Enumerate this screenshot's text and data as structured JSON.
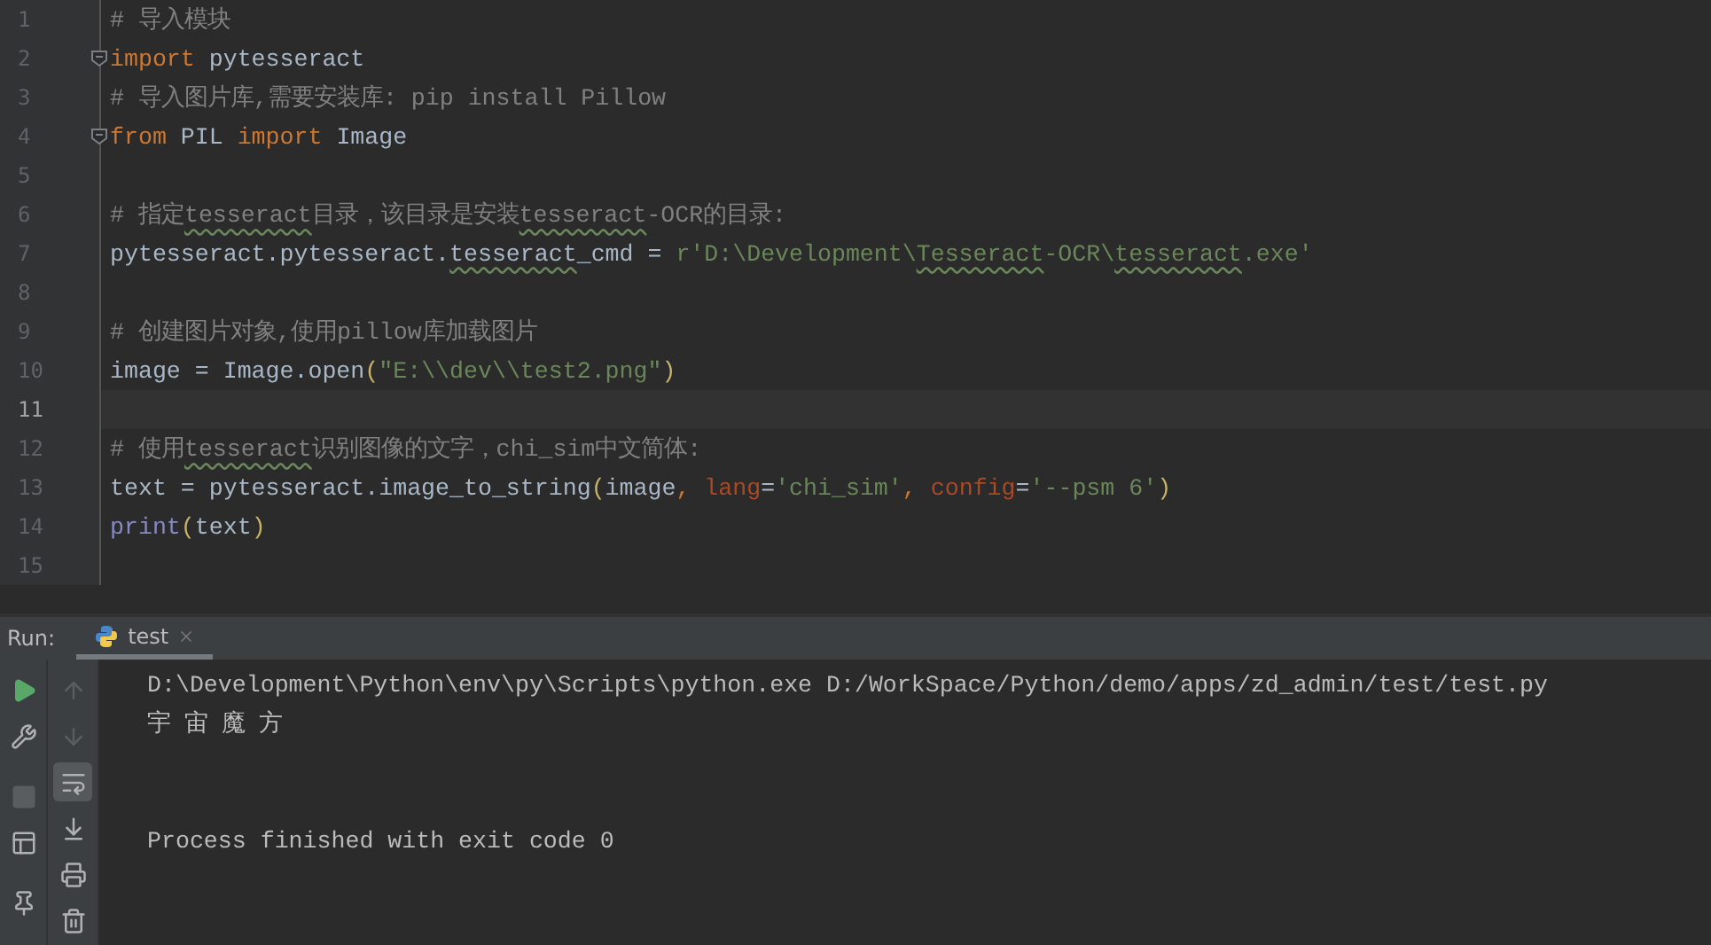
{
  "editor": {
    "lines": [
      {
        "number": "1",
        "current": false,
        "tokens": [
          {
            "kind": "comment",
            "text": "# 导入模块"
          }
        ]
      },
      {
        "number": "2",
        "current": false,
        "fold": true,
        "tokens": [
          {
            "kind": "keyword",
            "text": "import"
          },
          {
            "kind": "plain",
            "text": " pytesseract"
          }
        ]
      },
      {
        "number": "3",
        "current": false,
        "tokens": [
          {
            "kind": "comment",
            "text": "# 导入图片库,需要安装库: pip install Pillow"
          }
        ]
      },
      {
        "number": "4",
        "current": false,
        "fold": true,
        "tokens": [
          {
            "kind": "keyword",
            "text": "from"
          },
          {
            "kind": "plain",
            "text": " PIL "
          },
          {
            "kind": "keyword",
            "text": "import"
          },
          {
            "kind": "plain",
            "text": " Image"
          }
        ]
      },
      {
        "number": "5",
        "current": false
      },
      {
        "number": "6",
        "current": false,
        "tokens": [
          {
            "kind": "comment",
            "text": "# 指定"
          },
          {
            "kind": "comment_typo",
            "text": "tesseract"
          },
          {
            "kind": "comment",
            "text": "目录，该目录是安装"
          },
          {
            "kind": "comment_typo",
            "text": "tesseract"
          },
          {
            "kind": "comment",
            "text": "-OCR的目录:"
          }
        ]
      },
      {
        "number": "7",
        "current": false,
        "tokens": [
          {
            "kind": "plain",
            "text": "pytesseract.pytesseract."
          },
          {
            "kind": "plain_typo",
            "text": "tesseract"
          },
          {
            "kind": "plain",
            "text": "_cmd = "
          },
          {
            "kind": "string",
            "text": "r'D:\\Development\\"
          },
          {
            "kind": "string_typo",
            "text": "Tesseract"
          },
          {
            "kind": "string",
            "text": "-OCR\\"
          },
          {
            "kind": "string_typo",
            "text": "tesseract"
          },
          {
            "kind": "string",
            "text": ".exe'"
          }
        ]
      },
      {
        "number": "8",
        "current": false
      },
      {
        "number": "9",
        "current": false,
        "tokens": [
          {
            "kind": "comment",
            "text": "# 创建图片对象,使用pillow库加载图片"
          }
        ]
      },
      {
        "number": "10",
        "current": false,
        "tokens": [
          {
            "kind": "plain",
            "text": "image = Image.open"
          },
          {
            "kind": "paren",
            "text": "("
          },
          {
            "kind": "string",
            "text": "\"E:\\\\dev\\\\test2.png\""
          },
          {
            "kind": "paren",
            "text": ")"
          }
        ]
      },
      {
        "number": "11",
        "current": true
      },
      {
        "number": "12",
        "current": false,
        "tokens": [
          {
            "kind": "comment",
            "text": "# 使用"
          },
          {
            "kind": "comment_typo",
            "text": "tesseract"
          },
          {
            "kind": "comment",
            "text": "识别图像的文字，chi_sim中文简体:"
          }
        ]
      },
      {
        "number": "13",
        "current": false,
        "tokens": [
          {
            "kind": "plain",
            "text": "text = pytesseract.image_to_string"
          },
          {
            "kind": "paren",
            "text": "("
          },
          {
            "kind": "plain",
            "text": "image"
          },
          {
            "kind": "keyword",
            "text": ", "
          },
          {
            "kind": "param",
            "text": "lang"
          },
          {
            "kind": "plain",
            "text": "="
          },
          {
            "kind": "string",
            "text": "'chi_sim'"
          },
          {
            "kind": "keyword",
            "text": ", "
          },
          {
            "kind": "param",
            "text": "config"
          },
          {
            "kind": "plain",
            "text": "="
          },
          {
            "kind": "string",
            "text": "'--psm 6'"
          },
          {
            "kind": "paren",
            "text": ")"
          }
        ]
      },
      {
        "number": "14",
        "current": false,
        "tokens": [
          {
            "kind": "builtin",
            "text": "print"
          },
          {
            "kind": "paren",
            "text": "("
          },
          {
            "kind": "plain",
            "text": "text"
          },
          {
            "kind": "paren",
            "text": ")"
          }
        ]
      },
      {
        "number": "15",
        "current": false
      }
    ]
  },
  "run_panel": {
    "label": "Run:",
    "tabs": [
      {
        "label": "test",
        "selected": true
      }
    ],
    "left_tools": [
      {
        "disabled": false
      },
      {
        "disabled": false
      },
      {
        "disabled": true
      },
      {
        "disabled": false
      },
      {
        "disabled": false
      }
    ],
    "right_tools": [
      {
        "disabled": true,
        "selected": false
      },
      {
        "disabled": true,
        "selected": false
      },
      {
        "disabled": false,
        "selected": true
      },
      {
        "disabled": false,
        "selected": false
      },
      {
        "disabled": false,
        "selected": false
      },
      {
        "disabled": false,
        "selected": false
      }
    ],
    "console": [
      {
        "kind": "command",
        "text": "D:\\Development\\Python\\env\\py\\Scripts\\python.exe D:/WorkSpace/Python/demo/apps/zd_admin/test/test.py"
      },
      {
        "kind": "output",
        "text": "宇 宙 魔 方"
      },
      {
        "kind": "status",
        "text": "Process finished with exit code 0"
      }
    ]
  }
}
